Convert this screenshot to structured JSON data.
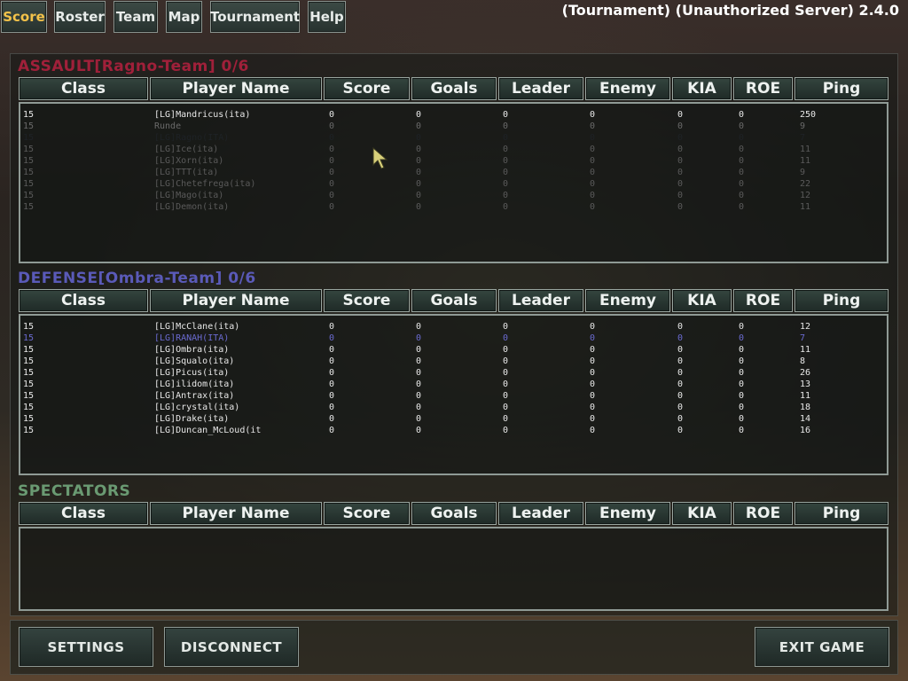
{
  "tabs": [
    {
      "label": "Score",
      "active": true
    },
    {
      "label": "Roster",
      "active": false
    },
    {
      "label": "Team",
      "active": false
    },
    {
      "label": "Map",
      "active": false
    },
    {
      "label": "Tournament",
      "active": false
    },
    {
      "label": "Help",
      "active": false
    }
  ],
  "server_title": "(Tournament) (Unauthorized Server) 2.4.0",
  "columns": [
    "Class",
    "Player Name",
    "Score",
    "Goals",
    "Leader",
    "Enemy",
    "KIA",
    "ROE",
    "Ping"
  ],
  "assault": {
    "title": "ASSAULT[Ragno-Team] 0/6",
    "color": "#a0203a",
    "players": [
      {
        "cls": "15",
        "name": "[LG]Mandricus(ita)",
        "score": "0",
        "goals": "0",
        "leader": "0",
        "enemy": "0",
        "kia": "0",
        "roe": "0",
        "ping": "250",
        "color": "#e8e8e8"
      },
      {
        "cls": "15",
        "name": "Runde",
        "score": "0",
        "goals": "0",
        "leader": "0",
        "enemy": "0",
        "kia": "0",
        "roe": "0",
        "ping": "9",
        "color": "#6a6a6a"
      },
      {
        "cls": "15",
        "name": "[LG]Ragno(ITA)",
        "score": "0",
        "goals": "0",
        "leader": "0",
        "enemy": "0",
        "kia": "0",
        "roe": "0",
        "ping": "7",
        "color": "#1e2226"
      },
      {
        "cls": "15",
        "name": "[LG]Ice(ita)",
        "score": "0",
        "goals": "0",
        "leader": "0",
        "enemy": "0",
        "kia": "0",
        "roe": "0",
        "ping": "11",
        "color": "#5a5a5a"
      },
      {
        "cls": "15",
        "name": "[LG]Xorn(ita)",
        "score": "0",
        "goals": "0",
        "leader": "0",
        "enemy": "0",
        "kia": "0",
        "roe": "0",
        "ping": "11",
        "color": "#5a5a5a"
      },
      {
        "cls": "15",
        "name": "[LG]TTT(ita)",
        "score": "0",
        "goals": "0",
        "leader": "0",
        "enemy": "0",
        "kia": "0",
        "roe": "0",
        "ping": "9",
        "color": "#5a5a5a"
      },
      {
        "cls": "15",
        "name": "[LG]Chetefrega(ita)",
        "score": "0",
        "goals": "0",
        "leader": "0",
        "enemy": "0",
        "kia": "0",
        "roe": "0",
        "ping": "22",
        "color": "#5a5a5a"
      },
      {
        "cls": "15",
        "name": "[LG]Mago(ita)",
        "score": "0",
        "goals": "0",
        "leader": "0",
        "enemy": "0",
        "kia": "0",
        "roe": "0",
        "ping": "12",
        "color": "#5a5a5a"
      },
      {
        "cls": "15",
        "name": "[LG]Demon(ita)",
        "score": "0",
        "goals": "0",
        "leader": "0",
        "enemy": "0",
        "kia": "0",
        "roe": "0",
        "ping": "11",
        "color": "#5a5a5a"
      }
    ]
  },
  "defense": {
    "title": "DEFENSE[Ombra-Team] 0/6",
    "color": "#5a5ab8",
    "players": [
      {
        "cls": "15",
        "name": "[LG]McClane(ita)",
        "score": "0",
        "goals": "0",
        "leader": "0",
        "enemy": "0",
        "kia": "0",
        "roe": "0",
        "ping": "12",
        "color": "#e8e8e8"
      },
      {
        "cls": "15",
        "name": "[LG]RANAH(ITA)",
        "score": "0",
        "goals": "0",
        "leader": "0",
        "enemy": "0",
        "kia": "0",
        "roe": "0",
        "ping": "7",
        "color": "#6a6ad0"
      },
      {
        "cls": "15",
        "name": "[LG]Ombra(ita)",
        "score": "0",
        "goals": "0",
        "leader": "0",
        "enemy": "0",
        "kia": "0",
        "roe": "0",
        "ping": "11",
        "color": "#e8e8e8"
      },
      {
        "cls": "15",
        "name": "[LG]Squalo(ita)",
        "score": "0",
        "goals": "0",
        "leader": "0",
        "enemy": "0",
        "kia": "0",
        "roe": "0",
        "ping": "8",
        "color": "#e8e8e8"
      },
      {
        "cls": "15",
        "name": "[LG]Picus(ita)",
        "score": "0",
        "goals": "0",
        "leader": "0",
        "enemy": "0",
        "kia": "0",
        "roe": "0",
        "ping": "26",
        "color": "#e8e8e8"
      },
      {
        "cls": "15",
        "name": "[LG]ilidom(ita)",
        "score": "0",
        "goals": "0",
        "leader": "0",
        "enemy": "0",
        "kia": "0",
        "roe": "0",
        "ping": "13",
        "color": "#e8e8e8"
      },
      {
        "cls": "15",
        "name": "[LG]Antrax(ita)",
        "score": "0",
        "goals": "0",
        "leader": "0",
        "enemy": "0",
        "kia": "0",
        "roe": "0",
        "ping": "11",
        "color": "#e8e8e8"
      },
      {
        "cls": "15",
        "name": "[LG]crystal(ita)",
        "score": "0",
        "goals": "0",
        "leader": "0",
        "enemy": "0",
        "kia": "0",
        "roe": "0",
        "ping": "18",
        "color": "#e8e8e8"
      },
      {
        "cls": "15",
        "name": "[LG]Drake(ita)",
        "score": "0",
        "goals": "0",
        "leader": "0",
        "enemy": "0",
        "kia": "0",
        "roe": "0",
        "ping": "14",
        "color": "#e8e8e8"
      },
      {
        "cls": "15",
        "name": "[LG]Duncan_McLoud(it",
        "score": "0",
        "goals": "0",
        "leader": "0",
        "enemy": "0",
        "kia": "0",
        "roe": "0",
        "ping": "16",
        "color": "#e8e8e8"
      }
    ]
  },
  "spectators": {
    "title": "SPECTATORS",
    "color": "#6a9a72",
    "players": []
  },
  "buttons": {
    "settings": "SETTINGS",
    "disconnect": "DISCONNECT",
    "exit": "EXIT GAME"
  },
  "icons": {
    "cursor": "arrow-cursor-icon"
  }
}
